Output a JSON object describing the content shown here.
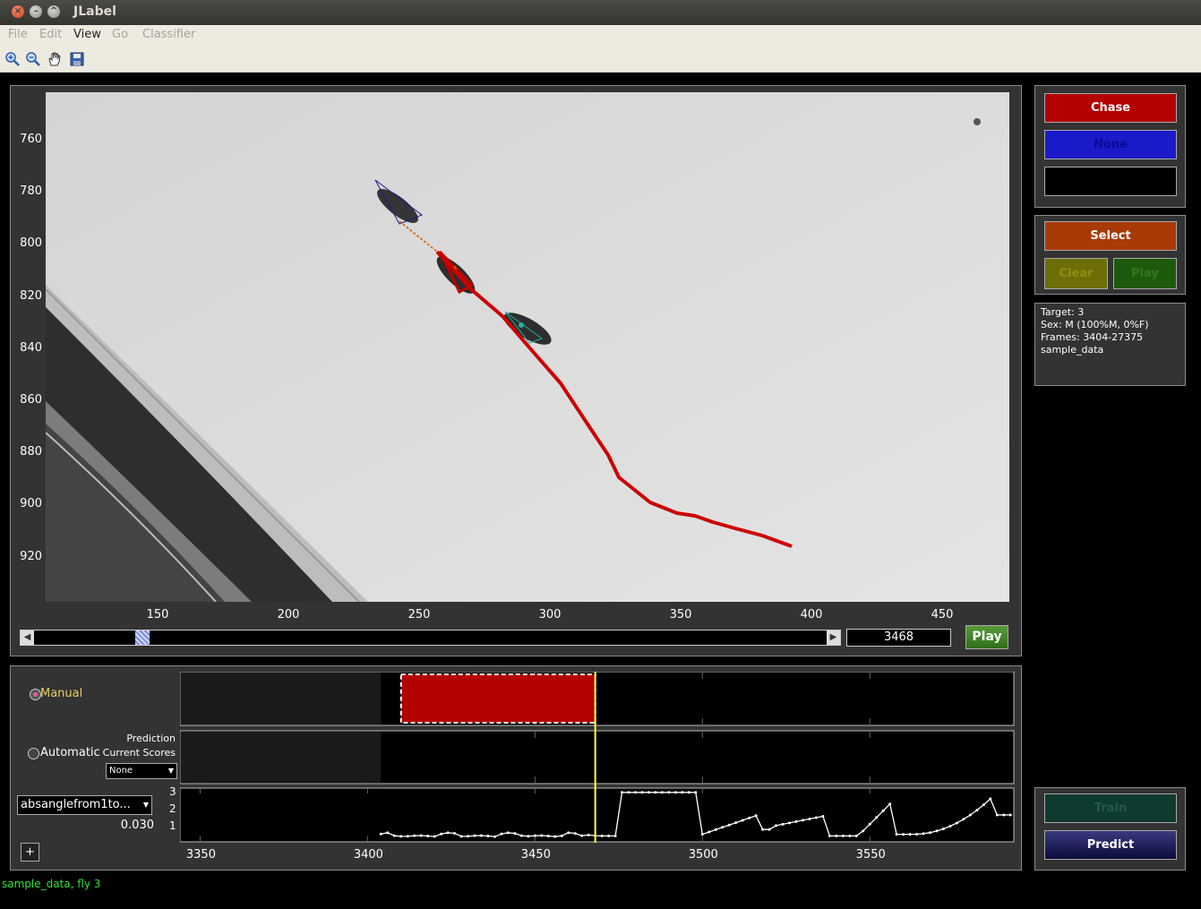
{
  "window": {
    "title": "JLabel"
  },
  "menu": [
    "File",
    "Edit",
    "View",
    "Go",
    "Classifier"
  ],
  "toolbar": {
    "icons": [
      "zoom-in-icon",
      "zoom-out-icon",
      "pan-hand-icon",
      "save-icon"
    ]
  },
  "video": {
    "y_ticks": [
      "760",
      "780",
      "800",
      "820",
      "840",
      "860",
      "880",
      "900",
      "920"
    ],
    "x_ticks": [
      "150",
      "200",
      "250",
      "300",
      "350",
      "400",
      "450"
    ],
    "frame_value": "3468",
    "play_label": "Play",
    "slider_fraction": 0.13
  },
  "labels_panel": {
    "chase": "Chase",
    "none": "None",
    "chase_color": "#b30000",
    "none_color": "#1a1ac8"
  },
  "select_panel": {
    "select": "Select",
    "clear": "Clear",
    "play": "Play"
  },
  "info": {
    "target": "Target: 3",
    "sex": "Sex: M (100%M, 0%F)",
    "frames": "Frames: 3404-27375",
    "dataset": "sample_data"
  },
  "timeline": {
    "manual": "Manual",
    "automatic": "Automatic",
    "prediction": "Prediction",
    "current_scores": "Current Scores",
    "scores_select": "None",
    "feature_select": "absanglefrom1to...",
    "feature_value": "0.030",
    "plus": "+",
    "y_ticks": [
      "3",
      "2",
      "1"
    ],
    "x_ticks": [
      "3350",
      "3400",
      "3450",
      "3500",
      "3550"
    ],
    "current_frame": 3468,
    "labeled_range": [
      3410,
      3468
    ]
  },
  "train_panel": {
    "train": "Train",
    "predict": "Predict"
  },
  "status": "sample_data, fly 3"
}
